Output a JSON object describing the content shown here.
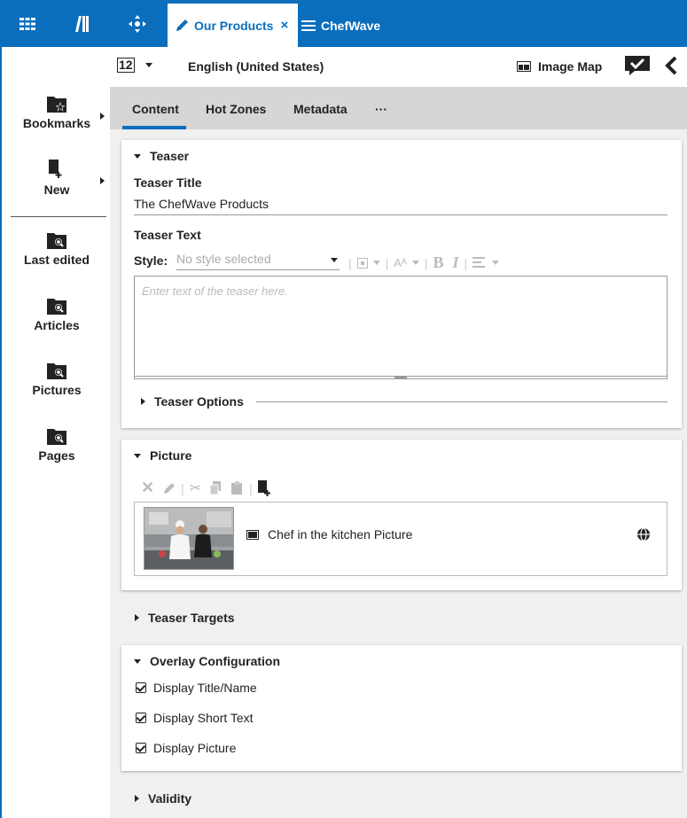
{
  "topbar": {
    "active_tab": {
      "label": "Our Products",
      "close": "×"
    },
    "second_tab": {
      "label": "ChefWave"
    }
  },
  "sidebar": {
    "items": [
      {
        "label": "Bookmarks",
        "icon": "bookmark-folder-icon"
      },
      {
        "label": "New",
        "icon": "new-document-icon"
      },
      {
        "label": "Last edited",
        "icon": "folder-search-icon"
      },
      {
        "label": "Articles",
        "icon": "folder-search-icon"
      },
      {
        "label": "Pictures",
        "icon": "folder-search-icon"
      },
      {
        "label": "Pages",
        "icon": "folder-search-icon"
      }
    ]
  },
  "docbar": {
    "site_indicator": "12",
    "language": "English (United States)",
    "image_map": "Image Map"
  },
  "content_tabs": [
    "Content",
    "Hot Zones",
    "Metadata",
    "···"
  ],
  "teaser": {
    "header": "Teaser",
    "title_label": "Teaser Title",
    "title_value": "The ChefWave Products",
    "text_label": "Teaser Text",
    "style_label": "Style:",
    "style_value": "No style selected",
    "text_placeholder": "Enter text of the teaser here.",
    "options": "Teaser Options"
  },
  "picture": {
    "header": "Picture",
    "item_label": "Chef in the kitchen Picture"
  },
  "teaser_targets": "Teaser Targets",
  "overlay": {
    "header": "Overlay Configuration",
    "options": [
      "Display Title/Name",
      "Display Short Text",
      "Display Picture"
    ]
  },
  "validity": "Validity",
  "colors": {
    "accent": "#0a6ebd"
  }
}
